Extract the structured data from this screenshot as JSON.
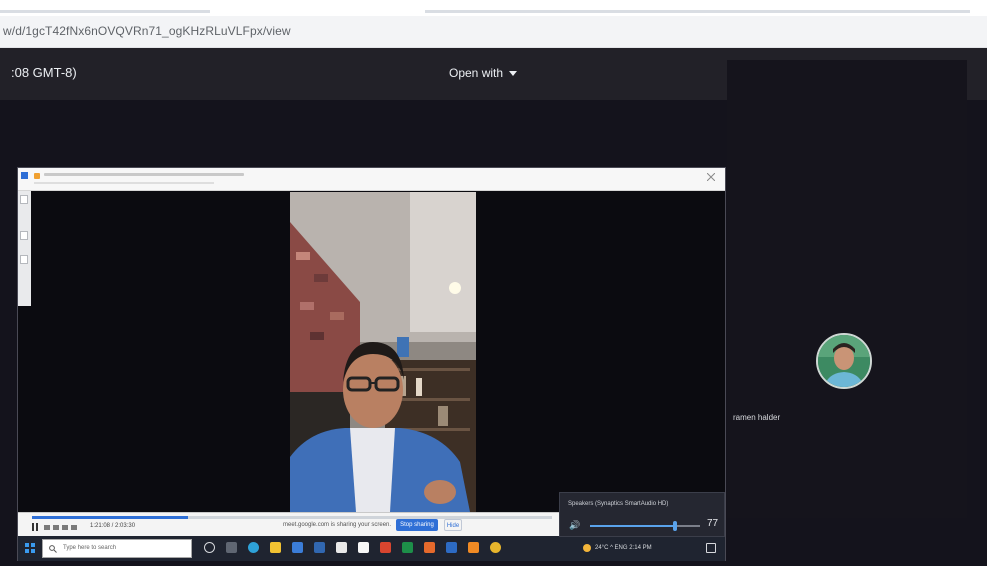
{
  "browser": {
    "url": "w/d/1gcT42fNx6nOVQVRn71_ogKHzRLuVLFpx/view"
  },
  "viewer": {
    "file_title": ":08 GMT-8)",
    "open_with_label": "Open with"
  },
  "meeting": {
    "participant_name": "ramen halder",
    "avatar_icon": "participant-avatar"
  },
  "player": {
    "progress": 0.3,
    "time": "1:21:08 / 2:03:30",
    "share_message": "meet.google.com is sharing your screen.",
    "stop_sharing_label": "Stop sharing",
    "hide_label": "Hide"
  },
  "taskbar": {
    "search_placeholder": "Type here to search",
    "tray_text": "24°C  ^  ENG  2:14 PM"
  },
  "volume": {
    "device": "Speakers (Synaptics SmartAudio HD)",
    "level": 77,
    "level_label": "77"
  },
  "colors": {
    "viewer_bg": "#14131c",
    "header_bg": "#222128",
    "accent_blue": "#2f6fd6",
    "taskbar_bg": "#1f2430"
  }
}
